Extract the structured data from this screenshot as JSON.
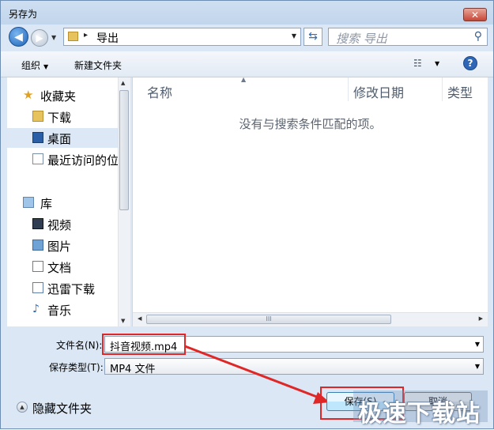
{
  "window": {
    "title": "另存为",
    "close_label": "✕"
  },
  "nav": {
    "back_glyph": "◀",
    "forward_glyph": "▶",
    "address": {
      "separator": "▸",
      "path": "导出"
    },
    "refresh_glyph": "⇆",
    "search": {
      "placeholder": "搜索 导出",
      "icon": "search-icon"
    }
  },
  "toolbar": {
    "organize_label": "组织",
    "new_folder_label": "新建文件夹",
    "view_glyph": "☷",
    "help_glyph": "?"
  },
  "sidebar": {
    "items": [
      {
        "label": "收藏夹",
        "icon": "star-icon"
      },
      {
        "label": "下载",
        "icon": "folder-icon"
      },
      {
        "label": "桌面",
        "icon": "desktop-icon",
        "selected": true
      },
      {
        "label": "最近访问的位置",
        "icon": "recent-places-icon"
      },
      {
        "label": "库",
        "icon": "library-icon"
      },
      {
        "label": "视频",
        "icon": "video-icon"
      },
      {
        "label": "图片",
        "icon": "picture-icon"
      },
      {
        "label": "文档",
        "icon": "document-icon"
      },
      {
        "label": "迅雷下载",
        "icon": "download-icon"
      },
      {
        "label": "音乐",
        "icon": "music-icon"
      }
    ]
  },
  "filelist": {
    "columns": [
      "名称",
      "修改日期",
      "类型"
    ],
    "empty_message": "没有与搜索条件匹配的项。",
    "hscroll_grip": "III"
  },
  "form": {
    "filename_label": "文件名(N):",
    "filename_value": "抖音视频.mp4",
    "filetype_label": "保存类型(T):",
    "filetype_value": "MP4 文件"
  },
  "footer": {
    "hide_folders_label": "隐藏文件夹",
    "save_label": "保存(S)",
    "cancel_label": "取消"
  },
  "watermark": {
    "text": "极速下载站"
  },
  "colors": {
    "annotation_red": "#e02727",
    "accent_blue": "#2f66b5"
  }
}
